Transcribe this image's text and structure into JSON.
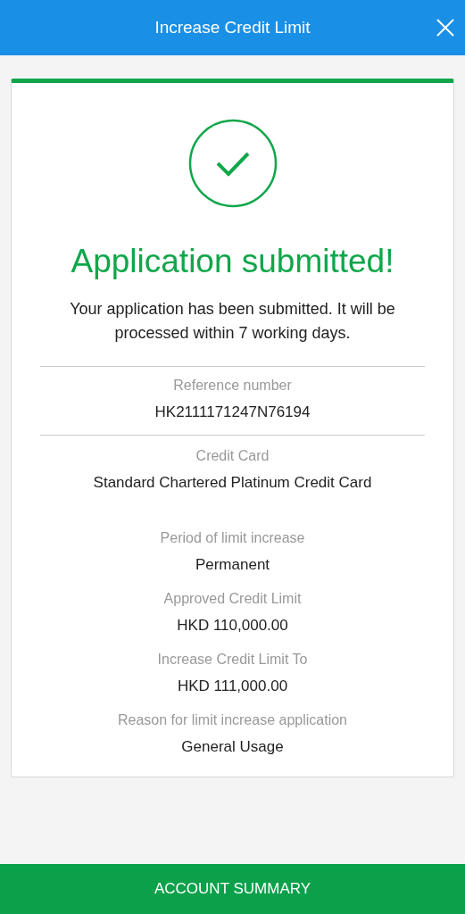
{
  "header": {
    "title": "Increase Credit Limit"
  },
  "status": {
    "title": "Application submitted!",
    "message": "Your application has been submitted. It will be processed within 7 working days."
  },
  "reference": {
    "label": "Reference number",
    "value": "HK2111171247N76194"
  },
  "card": {
    "label": "Credit Card",
    "value": "Standard Chartered Platinum Credit Card"
  },
  "details": [
    {
      "label": "Period of limit increase",
      "value": "Permanent"
    },
    {
      "label": "Approved Credit Limit",
      "value": "HKD 110,000.00"
    },
    {
      "label": "Increase Credit Limit To",
      "value": "HKD 111,000.00"
    },
    {
      "label": "Reason for limit increase application",
      "value": "General Usage"
    }
  ],
  "footer_button": "ACCOUNT SUMMARY"
}
